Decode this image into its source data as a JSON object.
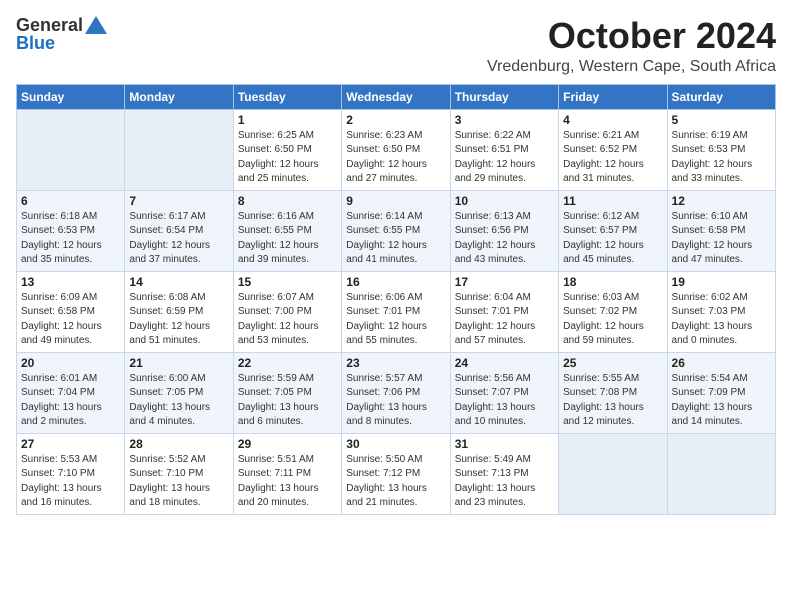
{
  "logo": {
    "general": "General",
    "blue": "Blue"
  },
  "title": "October 2024",
  "location": "Vredenburg, Western Cape, South Africa",
  "headers": [
    "Sunday",
    "Monday",
    "Tuesday",
    "Wednesday",
    "Thursday",
    "Friday",
    "Saturday"
  ],
  "weeks": [
    [
      {
        "day": "",
        "info": ""
      },
      {
        "day": "",
        "info": ""
      },
      {
        "day": "1",
        "info": "Sunrise: 6:25 AM\nSunset: 6:50 PM\nDaylight: 12 hours\nand 25 minutes."
      },
      {
        "day": "2",
        "info": "Sunrise: 6:23 AM\nSunset: 6:50 PM\nDaylight: 12 hours\nand 27 minutes."
      },
      {
        "day": "3",
        "info": "Sunrise: 6:22 AM\nSunset: 6:51 PM\nDaylight: 12 hours\nand 29 minutes."
      },
      {
        "day": "4",
        "info": "Sunrise: 6:21 AM\nSunset: 6:52 PM\nDaylight: 12 hours\nand 31 minutes."
      },
      {
        "day": "5",
        "info": "Sunrise: 6:19 AM\nSunset: 6:53 PM\nDaylight: 12 hours\nand 33 minutes."
      }
    ],
    [
      {
        "day": "6",
        "info": "Sunrise: 6:18 AM\nSunset: 6:53 PM\nDaylight: 12 hours\nand 35 minutes."
      },
      {
        "day": "7",
        "info": "Sunrise: 6:17 AM\nSunset: 6:54 PM\nDaylight: 12 hours\nand 37 minutes."
      },
      {
        "day": "8",
        "info": "Sunrise: 6:16 AM\nSunset: 6:55 PM\nDaylight: 12 hours\nand 39 minutes."
      },
      {
        "day": "9",
        "info": "Sunrise: 6:14 AM\nSunset: 6:55 PM\nDaylight: 12 hours\nand 41 minutes."
      },
      {
        "day": "10",
        "info": "Sunrise: 6:13 AM\nSunset: 6:56 PM\nDaylight: 12 hours\nand 43 minutes."
      },
      {
        "day": "11",
        "info": "Sunrise: 6:12 AM\nSunset: 6:57 PM\nDaylight: 12 hours\nand 45 minutes."
      },
      {
        "day": "12",
        "info": "Sunrise: 6:10 AM\nSunset: 6:58 PM\nDaylight: 12 hours\nand 47 minutes."
      }
    ],
    [
      {
        "day": "13",
        "info": "Sunrise: 6:09 AM\nSunset: 6:58 PM\nDaylight: 12 hours\nand 49 minutes."
      },
      {
        "day": "14",
        "info": "Sunrise: 6:08 AM\nSunset: 6:59 PM\nDaylight: 12 hours\nand 51 minutes."
      },
      {
        "day": "15",
        "info": "Sunrise: 6:07 AM\nSunset: 7:00 PM\nDaylight: 12 hours\nand 53 minutes."
      },
      {
        "day": "16",
        "info": "Sunrise: 6:06 AM\nSunset: 7:01 PM\nDaylight: 12 hours\nand 55 minutes."
      },
      {
        "day": "17",
        "info": "Sunrise: 6:04 AM\nSunset: 7:01 PM\nDaylight: 12 hours\nand 57 minutes."
      },
      {
        "day": "18",
        "info": "Sunrise: 6:03 AM\nSunset: 7:02 PM\nDaylight: 12 hours\nand 59 minutes."
      },
      {
        "day": "19",
        "info": "Sunrise: 6:02 AM\nSunset: 7:03 PM\nDaylight: 13 hours\nand 0 minutes."
      }
    ],
    [
      {
        "day": "20",
        "info": "Sunrise: 6:01 AM\nSunset: 7:04 PM\nDaylight: 13 hours\nand 2 minutes."
      },
      {
        "day": "21",
        "info": "Sunrise: 6:00 AM\nSunset: 7:05 PM\nDaylight: 13 hours\nand 4 minutes."
      },
      {
        "day": "22",
        "info": "Sunrise: 5:59 AM\nSunset: 7:05 PM\nDaylight: 13 hours\nand 6 minutes."
      },
      {
        "day": "23",
        "info": "Sunrise: 5:57 AM\nSunset: 7:06 PM\nDaylight: 13 hours\nand 8 minutes."
      },
      {
        "day": "24",
        "info": "Sunrise: 5:56 AM\nSunset: 7:07 PM\nDaylight: 13 hours\nand 10 minutes."
      },
      {
        "day": "25",
        "info": "Sunrise: 5:55 AM\nSunset: 7:08 PM\nDaylight: 13 hours\nand 12 minutes."
      },
      {
        "day": "26",
        "info": "Sunrise: 5:54 AM\nSunset: 7:09 PM\nDaylight: 13 hours\nand 14 minutes."
      }
    ],
    [
      {
        "day": "27",
        "info": "Sunrise: 5:53 AM\nSunset: 7:10 PM\nDaylight: 13 hours\nand 16 minutes."
      },
      {
        "day": "28",
        "info": "Sunrise: 5:52 AM\nSunset: 7:10 PM\nDaylight: 13 hours\nand 18 minutes."
      },
      {
        "day": "29",
        "info": "Sunrise: 5:51 AM\nSunset: 7:11 PM\nDaylight: 13 hours\nand 20 minutes."
      },
      {
        "day": "30",
        "info": "Sunrise: 5:50 AM\nSunset: 7:12 PM\nDaylight: 13 hours\nand 21 minutes."
      },
      {
        "day": "31",
        "info": "Sunrise: 5:49 AM\nSunset: 7:13 PM\nDaylight: 13 hours\nand 23 minutes."
      },
      {
        "day": "",
        "info": ""
      },
      {
        "day": "",
        "info": ""
      }
    ]
  ]
}
